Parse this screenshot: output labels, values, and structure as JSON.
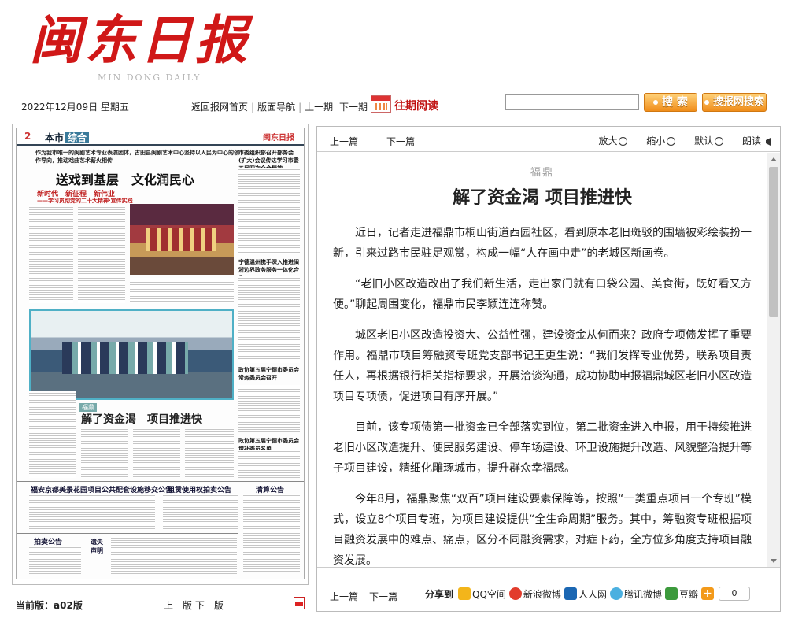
{
  "header": {
    "logo_cn": "闽东日报",
    "logo_en": "MIN DONG DAILY"
  },
  "navbar": {
    "date": "2022年12月09日 星期五",
    "home": "返回报网首页",
    "nav": "版面导航",
    "prev_issue": "上一期",
    "next_issue": "下一期",
    "past": "往期阅读",
    "search_btn": "搜 索",
    "site_search_btn": "搜报网搜索"
  },
  "paper": {
    "page_no": "2",
    "section": "本市",
    "section_tag": "综合",
    "logo": "闽东日报",
    "lead_kicker": "作为我市唯一的闽剧艺术专业表演团体，古田县闽剧艺术中心坚持以人民为中心的创作导向，推动戏曲艺术薪火相传",
    "lead_title": "送戏到基层　文化润民心",
    "lead_sub": "新时代　新征程　新伟业",
    "lead_sub2": "——学习贯彻党的二十大精神·宣传实践",
    "right_title1": "市委组织部召开部务会(扩大)会议传达学习市委五届四次全会精神",
    "right_title2": "宁德温州携手深入推进闽浙边界政务服务一体化合作",
    "right_title3": "政协第五届宁德市委员会常务委员会召开",
    "right_title4": "政协第五届宁德市委员会增补委员名单",
    "tag": "福鼎",
    "article_title": "解了资金渴　项目推进快",
    "ad1": "福安京都美景花园项目公共配套设施移交公告",
    "ad2": "租赁使用权拍卖公告",
    "ad3": "清算公告",
    "ad4": "拍卖公告",
    "ad5": "遗失声明"
  },
  "pagebar": {
    "current_label": "当前版：",
    "current_value": "a02版",
    "prev_page": "上一版",
    "next_page": "下一版"
  },
  "article_nav": {
    "prev": "上一篇",
    "next": "下一篇",
    "zoom_in": "放大",
    "zoom_out": "缩小",
    "default": "默认",
    "read": "朗读"
  },
  "article": {
    "kicker": "福鼎",
    "title": "解了资金渴 项目推进快",
    "paragraphs": [
      "近日，记者走进福鼎市桐山街道西园社区，看到原本老旧斑驳的围墙被彩绘装扮一新，引来过路市民驻足观赏，构成一幅“人在画中走”的老城区新画卷。",
      "“老旧小区改造改出了我们新生活，走出家门就有口袋公园、美食街，既好看又方便。”聊起周围变化，福鼎市民李颖连连称赞。",
      "城区老旧小区改造投资大、公益性强，建设资金从何而来？政府专项债发挥了重要作用。福鼎市项目筹融资专班党支部书记王更生说：“我们发挥专业优势，联系项目责任人，再根据银行相关指标要求，开展洽谈沟通，成功协助申报福鼎城区老旧小区改造项目专项债，促进项目有序开展。”",
      "目前，该专项债第一批资金已全部落实到位，第二批资金进入申报，用于持续推进老旧小区改造提升、便民服务建设、停车场建设、环卫设施提升改造、风貌整治提升等子项目建设，精细化雕琢城市，提升群众幸福感。",
      "今年8月，福鼎聚焦“双百”项目建设要素保障等，按照“一类重点项目一个专班”模式，设立8个项目专班，为项目建设提供“全生命周期”服务。其中，筹融资专班根据项目融资发展中的难点、痛点，区分不同融资需求，对症下药，全方位多角度支持项目融资发展。"
    ]
  },
  "share": {
    "label": "分享到",
    "qzone": "QQ空间",
    "weibo": "新浪微博",
    "renren": "人人网",
    "tencent": "腾讯微博",
    "douban": "豆瓣",
    "count": "0"
  },
  "colors": {
    "logo_red": "#d01818",
    "past_red": "#c01010",
    "button_orange": "#f08d1a"
  }
}
